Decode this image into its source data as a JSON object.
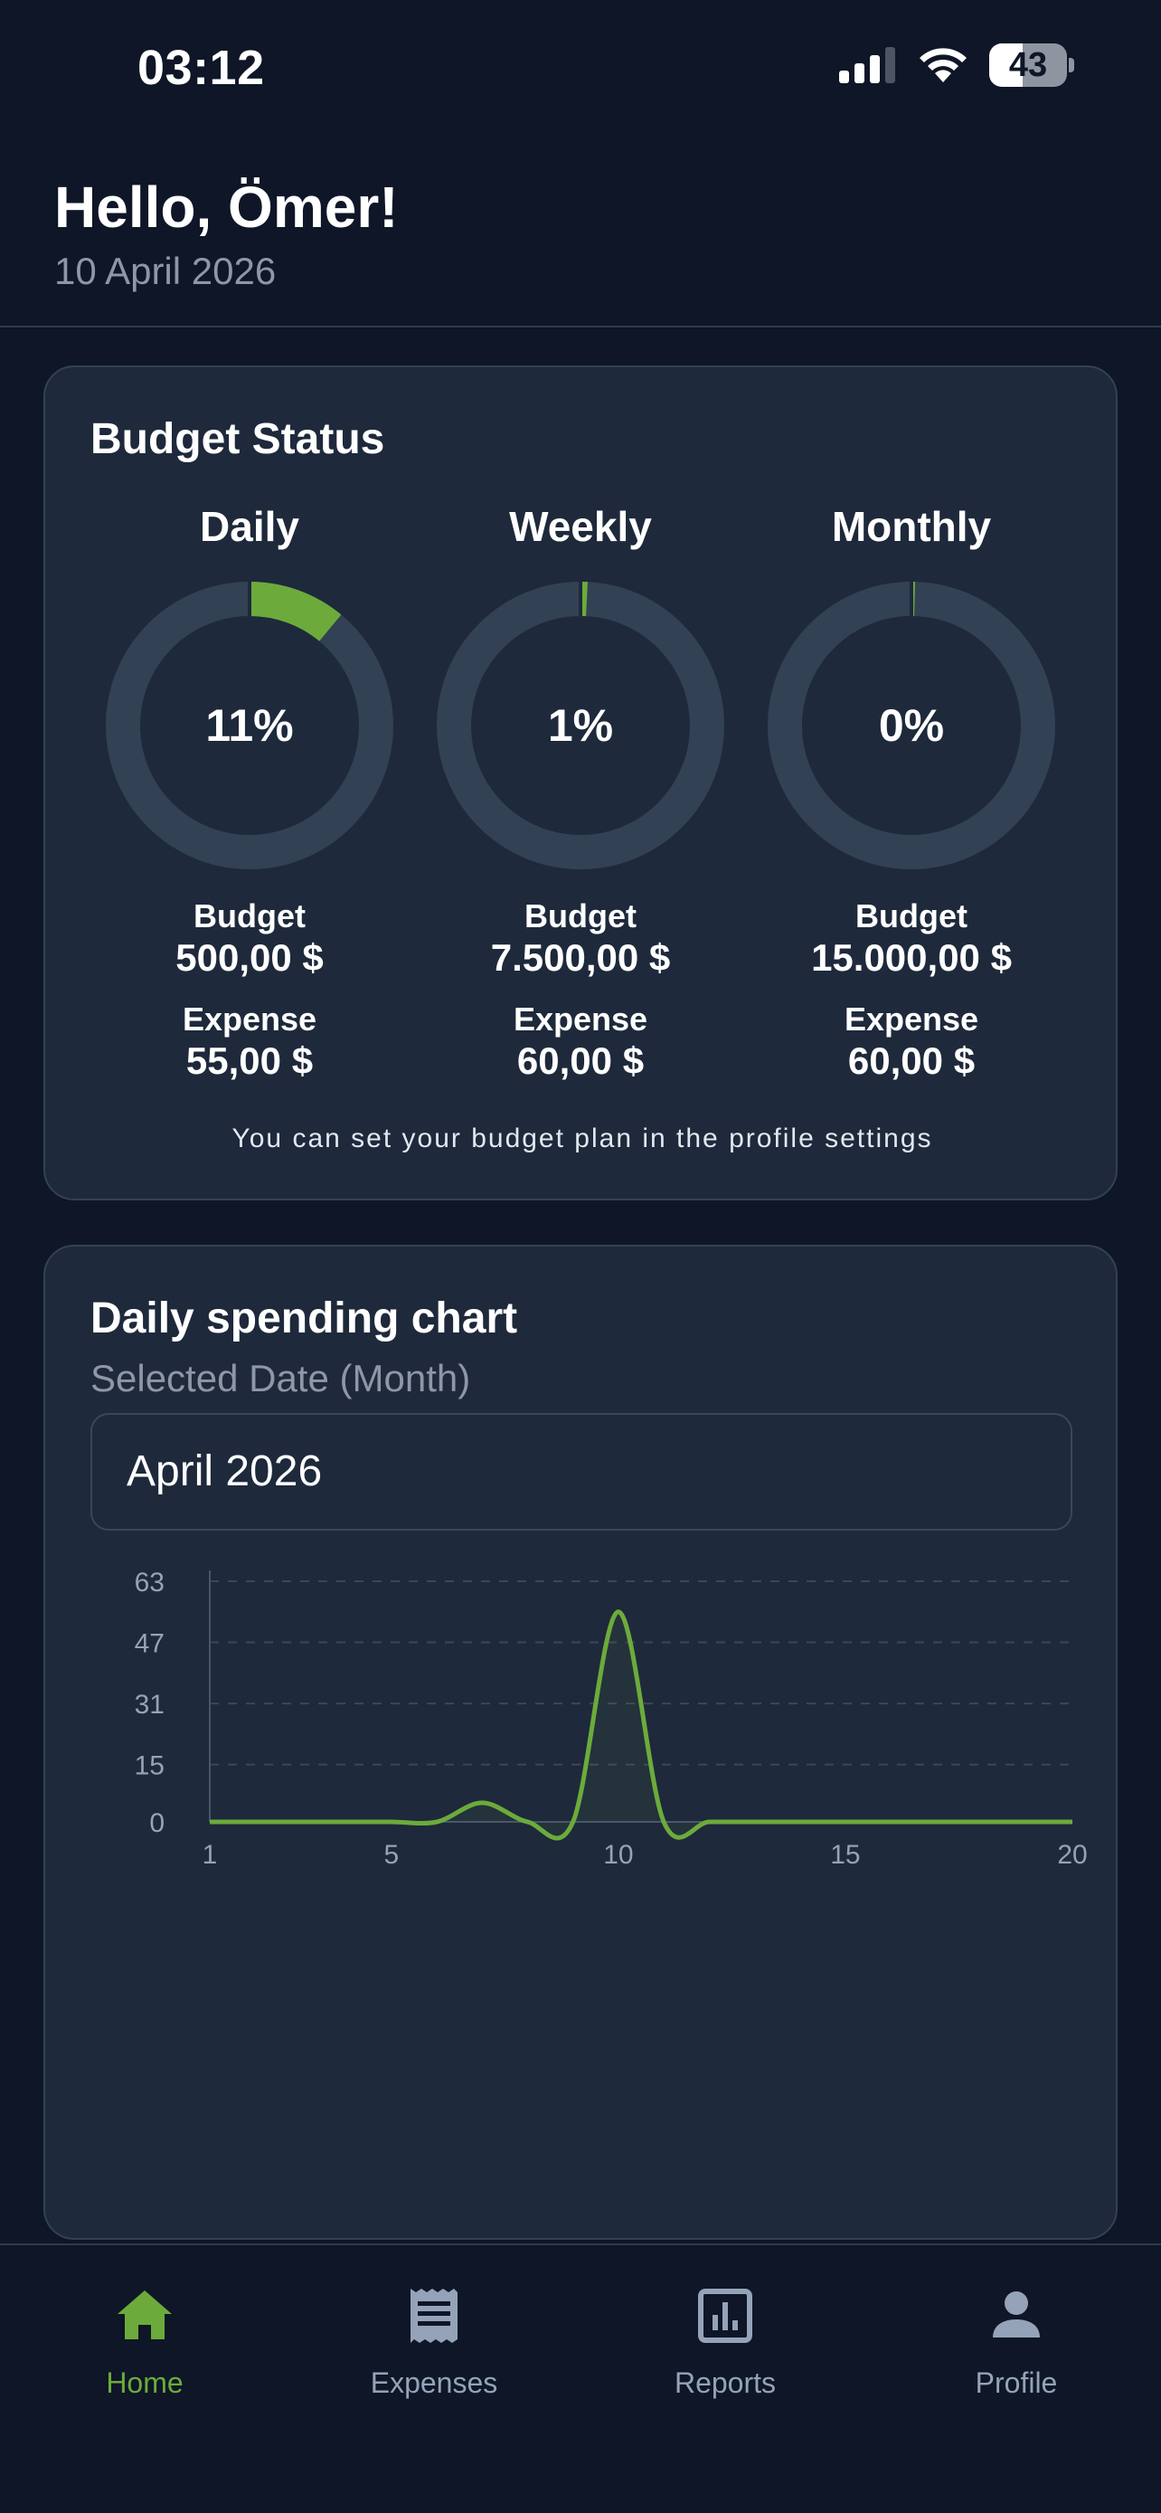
{
  "status_bar": {
    "time": "03:12",
    "battery_level": "43",
    "signal_icon": "cellular-signal-icon",
    "wifi_icon": "wifi-icon"
  },
  "header": {
    "greeting": "Hello, Ömer!",
    "date": "10 April 2026"
  },
  "budget_status": {
    "title": "Budget Status",
    "budget_label": "Budget",
    "expense_label": "Expense",
    "periods": [
      {
        "name": "Daily",
        "percent_text": "11%",
        "percent": 11,
        "budget": "500,00 $",
        "expense": "55,00 $"
      },
      {
        "name": "Weekly",
        "percent_text": "1%",
        "percent": 0.8,
        "budget": "7.500,00 $",
        "expense": "60,00 $"
      },
      {
        "name": "Monthly",
        "percent_text": "0%",
        "percent": 0.4,
        "budget": "15.000,00 $",
        "expense": "60,00 $"
      }
    ],
    "note": "You can set your budget plan in the profile settings"
  },
  "spending_chart": {
    "title": "Daily spending chart",
    "selector_label": "Selected Date (Month)",
    "selected_month": "April 2026"
  },
  "chart_data": {
    "type": "line",
    "title": "Daily spending chart",
    "x": [
      1,
      2,
      3,
      4,
      5,
      6,
      7,
      8,
      9,
      10,
      11,
      12,
      13,
      14,
      15,
      16,
      17,
      18,
      19,
      20
    ],
    "series": [
      {
        "values": [
          0,
          0,
          0,
          0,
          0,
          0,
          5,
          0,
          0,
          55,
          0,
          0,
          0,
          0,
          0,
          0,
          0,
          0,
          0,
          0
        ]
      }
    ],
    "x_ticks": [
      "1",
      "5",
      "10",
      "15",
      "20"
    ],
    "y_ticks": [
      "0",
      "15",
      "31",
      "47",
      "63"
    ],
    "xlim": [
      1,
      20
    ],
    "ylim": [
      0,
      63
    ],
    "grid": true
  },
  "colors": {
    "accent": "#6cab3b",
    "track": "#334155",
    "card_bg": "#1e293b",
    "page_bg": "#0e1627"
  },
  "nav": {
    "items": [
      {
        "label": "Home",
        "icon": "home-icon",
        "active": true
      },
      {
        "label": "Expenses",
        "icon": "receipt-icon",
        "active": false
      },
      {
        "label": "Reports",
        "icon": "bar-chart-icon",
        "active": false
      },
      {
        "label": "Profile",
        "icon": "person-icon",
        "active": false
      }
    ]
  }
}
